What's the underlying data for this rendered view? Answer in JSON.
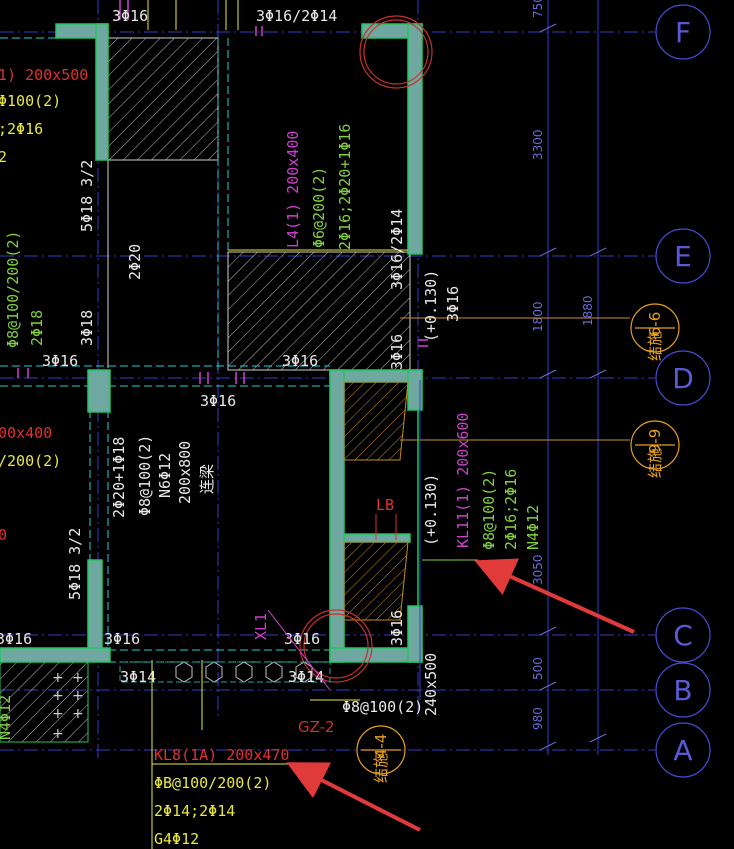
{
  "axes": [
    "F",
    "E",
    "D",
    "C",
    "B",
    "A"
  ],
  "dimensions": {
    "top": "750",
    "span_fe": "3300",
    "span_ed": "1800",
    "span_ed_2": "1880",
    "span_dc": "3050",
    "span_cb": "500",
    "span_ba": "980"
  },
  "section_markers": [
    {
      "top": "6-6",
      "bottom": "结施"
    },
    {
      "top": "9-9",
      "bottom": "结施"
    },
    {
      "top": "4-4",
      "bottom": "结施"
    }
  ],
  "rebar_labels": {
    "top_left_3phi16": "3Φ16",
    "top_3phi16_2phi14": "3Φ16/2Φ14",
    "mid_3phi16_1": "3Φ16",
    "mid_3phi16_2": "3Φ16",
    "mid_3phi16_3": "3Φ16",
    "left_3phi16": "3Φ16",
    "low_3phi16_1": "3Φ16",
    "low_3phi16_2": "3Φ16",
    "low_3phi16_3": "3Φ16",
    "low_3phi16_4": "3Φ16",
    "low_3phi14_1": "3Φ14",
    "low_3phi14_2": "3Φ14",
    "vert_5phi18_1": "5Φ18 3/2",
    "vert_2phi20": "2Φ20",
    "vert_3phi18": "3Φ18",
    "vert_3phi16_2phi14": "3Φ16/2Φ14",
    "vert_3phi16_a": "3Φ16",
    "vert_3phi16_b": "3Φ16",
    "vert_3phi16_c": "3Φ16",
    "vert_plus0130_a": "(+0.130)",
    "vert_5phi18_2": "5Φ18 3/2",
    "vert_plus0130_b": "(+0.130)"
  },
  "beams": {
    "l4_name": "L4(1) 200x400",
    "l4_stirrup": "Φ6@200(2)",
    "l4_bars": "2Φ16;2Φ20+1Φ16",
    "left_top_name": "1) 200x500",
    "left_top_stirrup": "Φ100(2)",
    "left_top_bars": ";2Φ16",
    "left_top_extra": "2",
    "left_vert_stirrup": "Φ8@100/200(2)",
    "left_vert_bars": "2Φ18",
    "left_mid_name": "00x400",
    "left_mid_stirrup": "/200(2)",
    "left_mid_0": "0",
    "center_bars": "2Φ20+1Φ18",
    "center_stirrup": "Φ8@100(2)",
    "center_n": "N6Φ12",
    "center_size": "200x800",
    "center_name": "连梁",
    "kl11_name": "KL11(1) 200x600",
    "kl11_stirrup": "Φ8@100(2)",
    "kl11_bars": "2Φ16;2Φ16",
    "kl11_n": "N4Φ12",
    "lb": "LB",
    "xl1": "XL1",
    "gz2": "GZ-2",
    "wall_size": "240x500",
    "bottom_stirrup": "Φ8@100(2)",
    "kl8_name": "KL8(1A) 200x470",
    "kl8_stirrup": "ΦB@100/200(2)",
    "kl8_bars": "2Φ14;2Φ14",
    "kl8_g": "G4Φ12",
    "left_edge_text": "N4Φ12"
  },
  "colors": {
    "background": "#000000",
    "beam_green": "#22c55e",
    "concrete_fill": "#6fa8a0",
    "annotation_yellow": "#e8e840",
    "magenta": "#d040d0",
    "red": "#e03030",
    "grid_blue": "#4040d0",
    "cyan": "#20d0d0",
    "arrow_red": "#e03a3a"
  }
}
